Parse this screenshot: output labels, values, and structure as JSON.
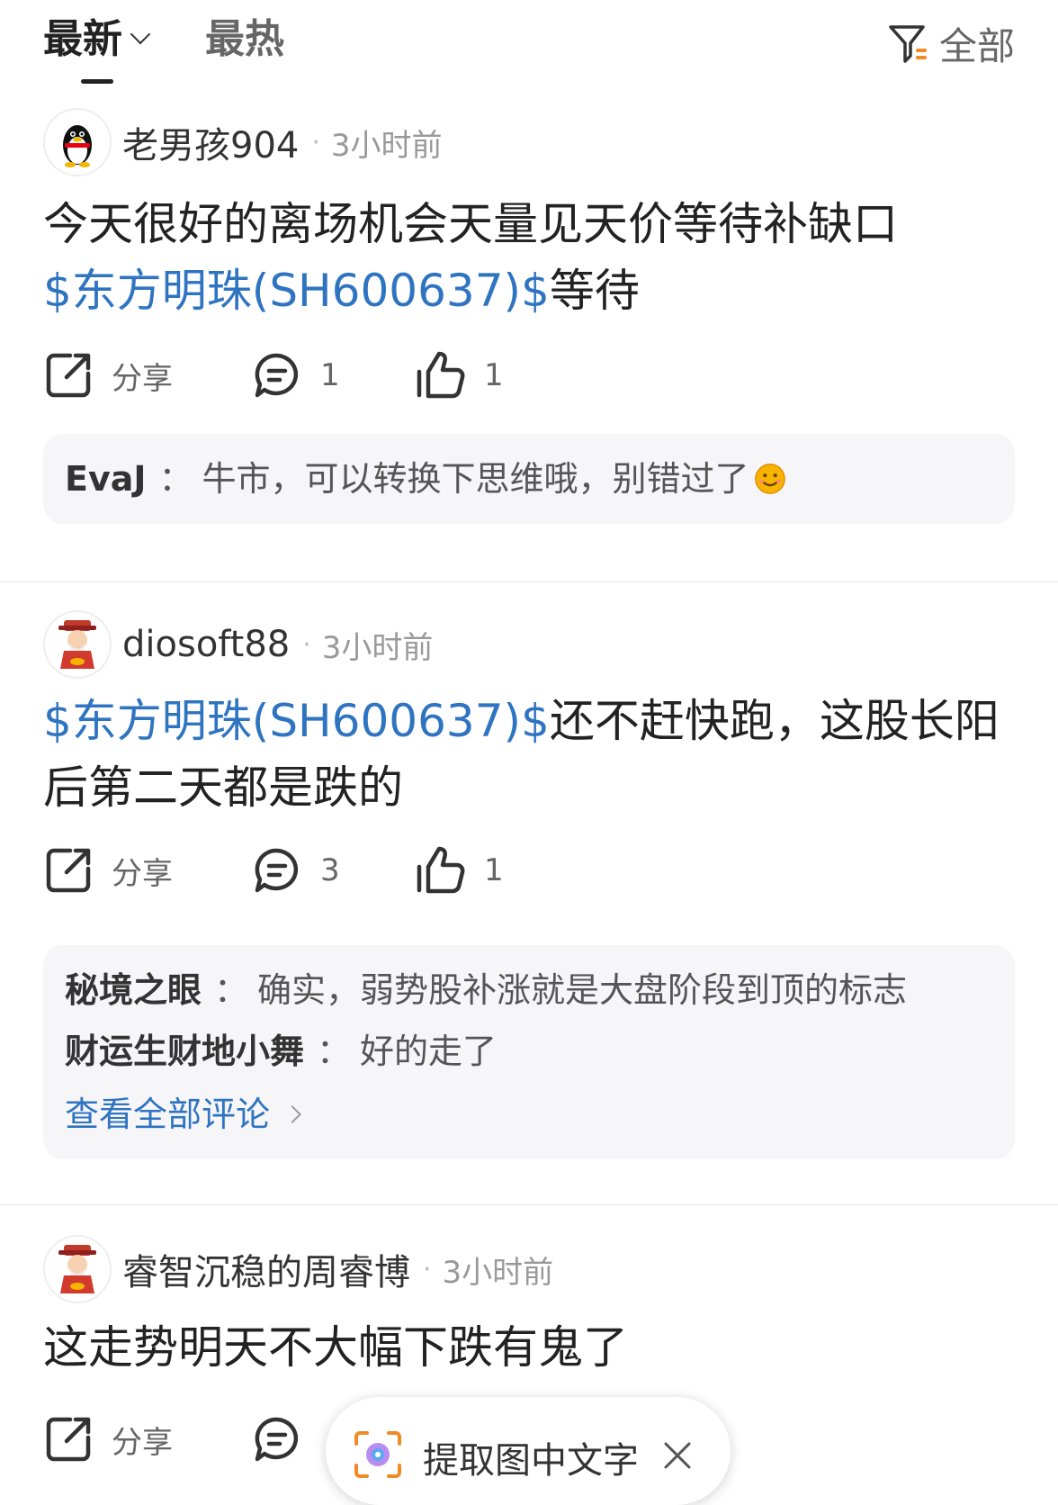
{
  "tabs": {
    "latest": "最新",
    "hot": "最热",
    "filter_label": "全部"
  },
  "posts": [
    {
      "username": "老男孩904",
      "time": "3小时前",
      "text_before": "今天很好的离场机会天量见天价等待补缺口",
      "stock": "$东方明珠(SH600637)$",
      "text_after": "等待",
      "share_label": "分享",
      "comment_count": "1",
      "like_count": "1",
      "comments": [
        {
          "name": "EvaJ",
          "colon": "：",
          "text": "牛市，可以转换下思维哦，别错过了"
        }
      ]
    },
    {
      "username": "diosoft88",
      "time": "3小时前",
      "stock": "$东方明珠(SH600637)$",
      "text_after": "还不赶快跑，这股长阳后第二天都是跌的",
      "share_label": "分享",
      "comment_count": "3",
      "like_count": "1",
      "comments": [
        {
          "name": "秘境之眼",
          "colon": "：",
          "text": "确实，弱势股补涨就是大盘阶段到顶的标志"
        },
        {
          "name": "财运生财地小舞",
          "colon": "：",
          "text": "好的走了"
        }
      ],
      "see_all": "查看全部评论"
    },
    {
      "username": "睿智沉稳的周睿博",
      "time": "3小时前",
      "text": "这走势明天不大幅下跌有鬼了",
      "share_label": "分享"
    }
  ],
  "ocr": {
    "label": "提取图中文字"
  },
  "colors": {
    "accent": "#2f74c0",
    "comment_bg": "#f6f6f8"
  },
  "icons": [
    "chevron-down-icon",
    "filter-icon",
    "share-icon",
    "comment-icon",
    "like-icon",
    "smile-emoji-icon",
    "close-icon",
    "ocr-scan-icon"
  ]
}
